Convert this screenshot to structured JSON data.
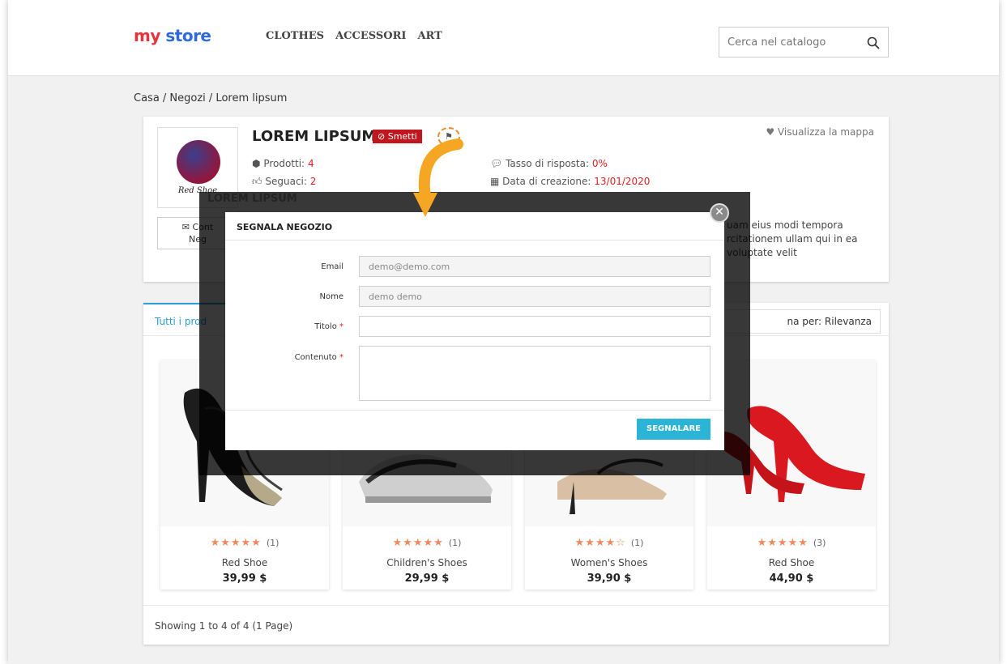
{
  "header": {
    "logo_part1": "my",
    "logo_part2": "store",
    "nav": [
      "CLOTHES",
      "ACCESSORI",
      "ART"
    ],
    "search_placeholder": "Cerca nel catalogo"
  },
  "breadcrumb": "Casa / Negozi / Lorem lipsum",
  "store": {
    "name": "LOREM LIPSUM",
    "badge": "⊘ Smetti",
    "logo_text": "Red Shoe",
    "contact_line1": "✉ Cont",
    "contact_line2": "Neg",
    "map_link": "♥ Visualizza la mappa",
    "products_label": "Prodotti:",
    "products_value": "4",
    "followers_label": "Seguaci:",
    "followers_value": "2",
    "response_label": "Tasso di risposta:",
    "response_value": "0%",
    "created_label": "Data di creazione:",
    "created_value": "13/01/2020",
    "desc": "uam eius modi tempora rcitationem ullam qui in ea voluptate velit"
  },
  "products_section": {
    "tab_all": "Tutti i prod",
    "sort_label": "na per:",
    "sort_value": "Rilevanza",
    "showing": "Showing 1 to 4 of 4 (1 Page)",
    "items": [
      {
        "name": "Red Shoe",
        "price": "39,99 $",
        "stars": "★★★★★",
        "count": "(1)",
        "rating": 5
      },
      {
        "name": "Children's Shoes",
        "price": "29,99 $",
        "stars": "★★★★★",
        "count": "(1)",
        "rating": 5
      },
      {
        "name": "Women's Shoes",
        "price": "39,90 $",
        "stars": "★★★★☆",
        "count": "(1)",
        "rating": 4
      },
      {
        "name": "Red Shoe",
        "price": "44,90 $",
        "stars": "★★★★★",
        "count": "(3)",
        "rating": 5
      }
    ]
  },
  "modal": {
    "title": "SEGNALA NEGOZIO",
    "email_label": "Email",
    "email_value": "demo@demo.com",
    "name_label": "Nome",
    "name_value": "demo demo",
    "title_label": "Titolo",
    "content_label": "Contenuto",
    "required_mark": "*",
    "submit": "SEGNALARE",
    "close": "✕"
  },
  "colors": {
    "accent_blue": "#2bb4d6",
    "badge_red": "#c0161d",
    "star_orange": "#f08a5d",
    "arrow_orange": "#f5a623"
  }
}
